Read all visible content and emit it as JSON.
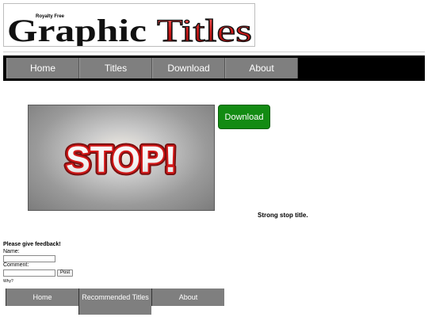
{
  "logo": {
    "tagline": "Royalty Free",
    "word1": "Graphic",
    "word2": "Titles"
  },
  "nav": {
    "items": [
      {
        "label": "Home"
      },
      {
        "label": "Titles"
      },
      {
        "label": "Download"
      },
      {
        "label": "About"
      }
    ]
  },
  "main": {
    "image_text": "STOP!",
    "download_label": "Download",
    "caption": "Strong stop title."
  },
  "feedback": {
    "heading": "Please give feedback!",
    "name_label": "Name:",
    "comment_label": "Comment:",
    "post_label": "Post",
    "why_label": "Why?"
  },
  "bottom_nav": {
    "items": [
      {
        "label": "Home"
      },
      {
        "label": "Recommended Titles"
      },
      {
        "label": "About"
      }
    ]
  },
  "colors": {
    "nav_bar": "#000000",
    "nav_item": "#7f7f7f",
    "download_button": "#138b13",
    "title_red": "#cc1a1a"
  }
}
